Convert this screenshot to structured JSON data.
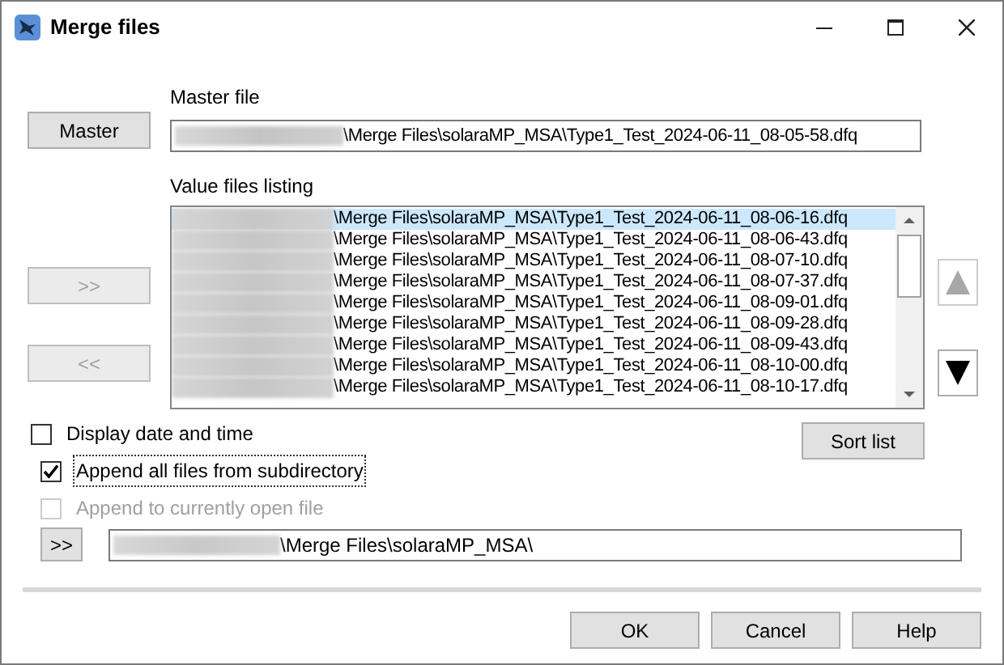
{
  "window": {
    "title": "Merge files"
  },
  "master_button": {
    "label": "Master"
  },
  "master_file": {
    "label": "Master file",
    "value": "\\Merge Files\\solaraMP_MSA\\Type1_Test_2024-06-11_08-05-58.dfq"
  },
  "value_files": {
    "label": "Value files listing",
    "items": [
      {
        "text": "\\Merge Files\\solaraMP_MSA\\Type1_Test_2024-06-11_08-06-16.dfq",
        "selected": true
      },
      {
        "text": "\\Merge Files\\solaraMP_MSA\\Type1_Test_2024-06-11_08-06-43.dfq",
        "selected": false
      },
      {
        "text": "\\Merge Files\\solaraMP_MSA\\Type1_Test_2024-06-11_08-07-10.dfq",
        "selected": false
      },
      {
        "text": "\\Merge Files\\solaraMP_MSA\\Type1_Test_2024-06-11_08-07-37.dfq",
        "selected": false
      },
      {
        "text": "\\Merge Files\\solaraMP_MSA\\Type1_Test_2024-06-11_08-09-01.dfq",
        "selected": false
      },
      {
        "text": "\\Merge Files\\solaraMP_MSA\\Type1_Test_2024-06-11_08-09-28.dfq",
        "selected": false
      },
      {
        "text": "\\Merge Files\\solaraMP_MSA\\Type1_Test_2024-06-11_08-09-43.dfq",
        "selected": false
      },
      {
        "text": "\\Merge Files\\solaraMP_MSA\\Type1_Test_2024-06-11_08-10-00.dfq",
        "selected": false
      },
      {
        "text": "\\Merge Files\\solaraMP_MSA\\Type1_Test_2024-06-11_08-10-17.dfq",
        "selected": false
      }
    ]
  },
  "move_buttons": [
    {
      "label": ">>",
      "disabled": true
    },
    {
      "label": "<<",
      "disabled": true
    }
  ],
  "order_buttons": [
    {
      "kind": "up",
      "disabled": true
    },
    {
      "kind": "down",
      "disabled": false
    }
  ],
  "sort_button": {
    "label": "Sort list"
  },
  "checkboxes": [
    {
      "label": "Display date and time",
      "checked": false,
      "disabled": false,
      "focused": false
    },
    {
      "label": "Append all files from subdirectory",
      "checked": true,
      "disabled": false,
      "focused": true
    },
    {
      "label": "Append to currently open file",
      "checked": false,
      "disabled": true,
      "focused": false
    }
  ],
  "browse_button": {
    "label": ">>"
  },
  "directory": {
    "value": "\\Merge Files\\solaraMP_MSA\\"
  },
  "footer_buttons": [
    "OK",
    "Cancel",
    "Help"
  ]
}
